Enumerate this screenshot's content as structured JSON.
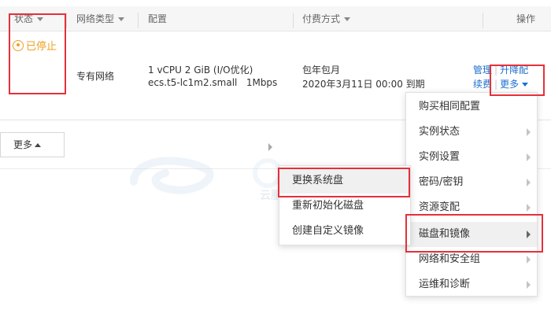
{
  "table": {
    "headers": {
      "status": "状态",
      "network_type": "网络类型",
      "config": "配置",
      "billing": "付费方式",
      "actions": "操作"
    },
    "row": {
      "status": "已停止",
      "network_type": "专有网络",
      "config_line1": "1 vCPU 2 GiB (I/O优化)",
      "config_line2": "ecs.t5-lc1m2.small   1Mbps",
      "billing_line1": "包年包月",
      "billing_line2": "2020年3月11日 00:00 到期",
      "action_manage": "管理",
      "action_upgrade": "升降配",
      "action_renew": "续费",
      "action_more": "更多"
    }
  },
  "bottom": {
    "more_label": "更多"
  },
  "menu_primary": {
    "items": [
      {
        "label": "购买相同配置"
      },
      {
        "label": "实例状态"
      },
      {
        "label": "实例设置"
      },
      {
        "label": "密码/密钥"
      },
      {
        "label": "资源变配"
      },
      {
        "label": "磁盘和镜像"
      },
      {
        "label": "网络和安全组"
      },
      {
        "label": "运维和诊断"
      }
    ]
  },
  "menu_submenu": {
    "items": [
      {
        "label": "更换系统盘"
      },
      {
        "label": "重新初始化磁盘"
      },
      {
        "label": "创建自定义镜像"
      }
    ]
  },
  "watermark_text": "云服务器  小白中企网",
  "colors": {
    "accent_link": "#1d6fcf",
    "stopped_status": "#f0a020",
    "highlight_box": "#e5303a"
  }
}
